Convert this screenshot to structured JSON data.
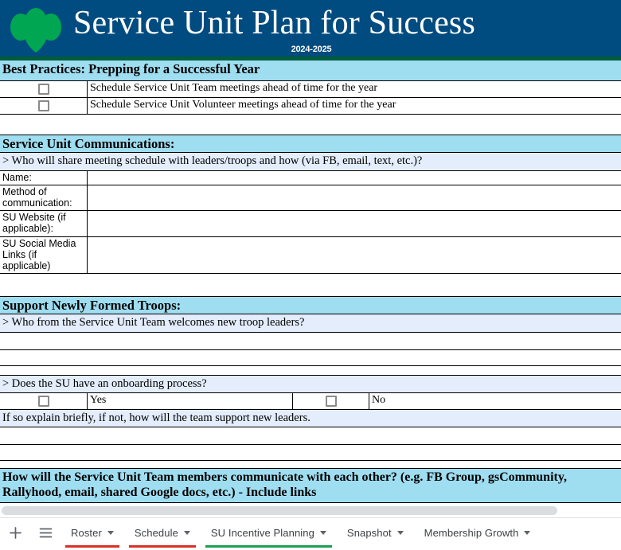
{
  "banner": {
    "title": "Service Unit Plan for Success",
    "subtitle": "2024-2025",
    "logo": "girl-scouts-trefoil-logo",
    "navy": "#004B7F",
    "green": "#00A651",
    "accent_strip": "#005C3A"
  },
  "colors": {
    "section_header_fill": "#9FDDF0",
    "prompt_fill": "#E3EDFB",
    "grid_line": "#000000",
    "checkbox_border": "#8A8A8A"
  },
  "sections": {
    "best_practices": {
      "heading": "Best Practices: Prepping for a Successful Year",
      "items": [
        {
          "checked": false,
          "label": "Schedule Service Unit Team meetings ahead of time for the year"
        },
        {
          "checked": false,
          "label": "Schedule Service Unit Volunteer meetings ahead of time for the year"
        }
      ]
    },
    "communications": {
      "heading": "Service Unit Communications:",
      "prompt": "> Who will share meeting schedule with leaders/troops and how (via FB, email, text, etc.)?",
      "fields": [
        {
          "label": "Name:",
          "value": ""
        },
        {
          "label": "Method of communication:",
          "value": ""
        },
        {
          "label": "SU Website (if applicable):",
          "value": ""
        },
        {
          "label": "SU Social Media Links (if applicable)",
          "value": ""
        }
      ]
    },
    "support_new_troops": {
      "heading": "Support Newly Formed Troops:",
      "prompt_welcome": "> Who from the Service Unit Team welcomes new troop leaders?",
      "answer_welcome": "",
      "prompt_onboarding": "> Does the SU have an onboarding process?",
      "options": [
        {
          "checked": false,
          "label": "Yes"
        },
        {
          "checked": false,
          "label": "No"
        }
      ],
      "prompt_explain": "If so explain briefly, if not, how will the team support new leaders.",
      "answer_explain": ""
    },
    "team_communication": {
      "heading_line1": "How will the Service Unit Team members communicate with each other? (e.g. FB Group, gsCommunity,",
      "heading_line2": "Rallyhood, email, shared Google docs, etc.) - Include links"
    }
  },
  "tabbar": {
    "add_sheet_label": "+",
    "all_sheets_label": "all-sheets-menu",
    "tabs": [
      {
        "label": "Roster",
        "underline": "#D93025",
        "active": false
      },
      {
        "label": "Schedule",
        "underline": "#D93025",
        "active": false
      },
      {
        "label": "SU Incentive Planning",
        "underline": "#1E9E52",
        "active": true
      },
      {
        "label": "Snapshot",
        "underline": "transparent",
        "active": false
      },
      {
        "label": "Membership Growth",
        "underline": "transparent",
        "active": false
      }
    ]
  }
}
